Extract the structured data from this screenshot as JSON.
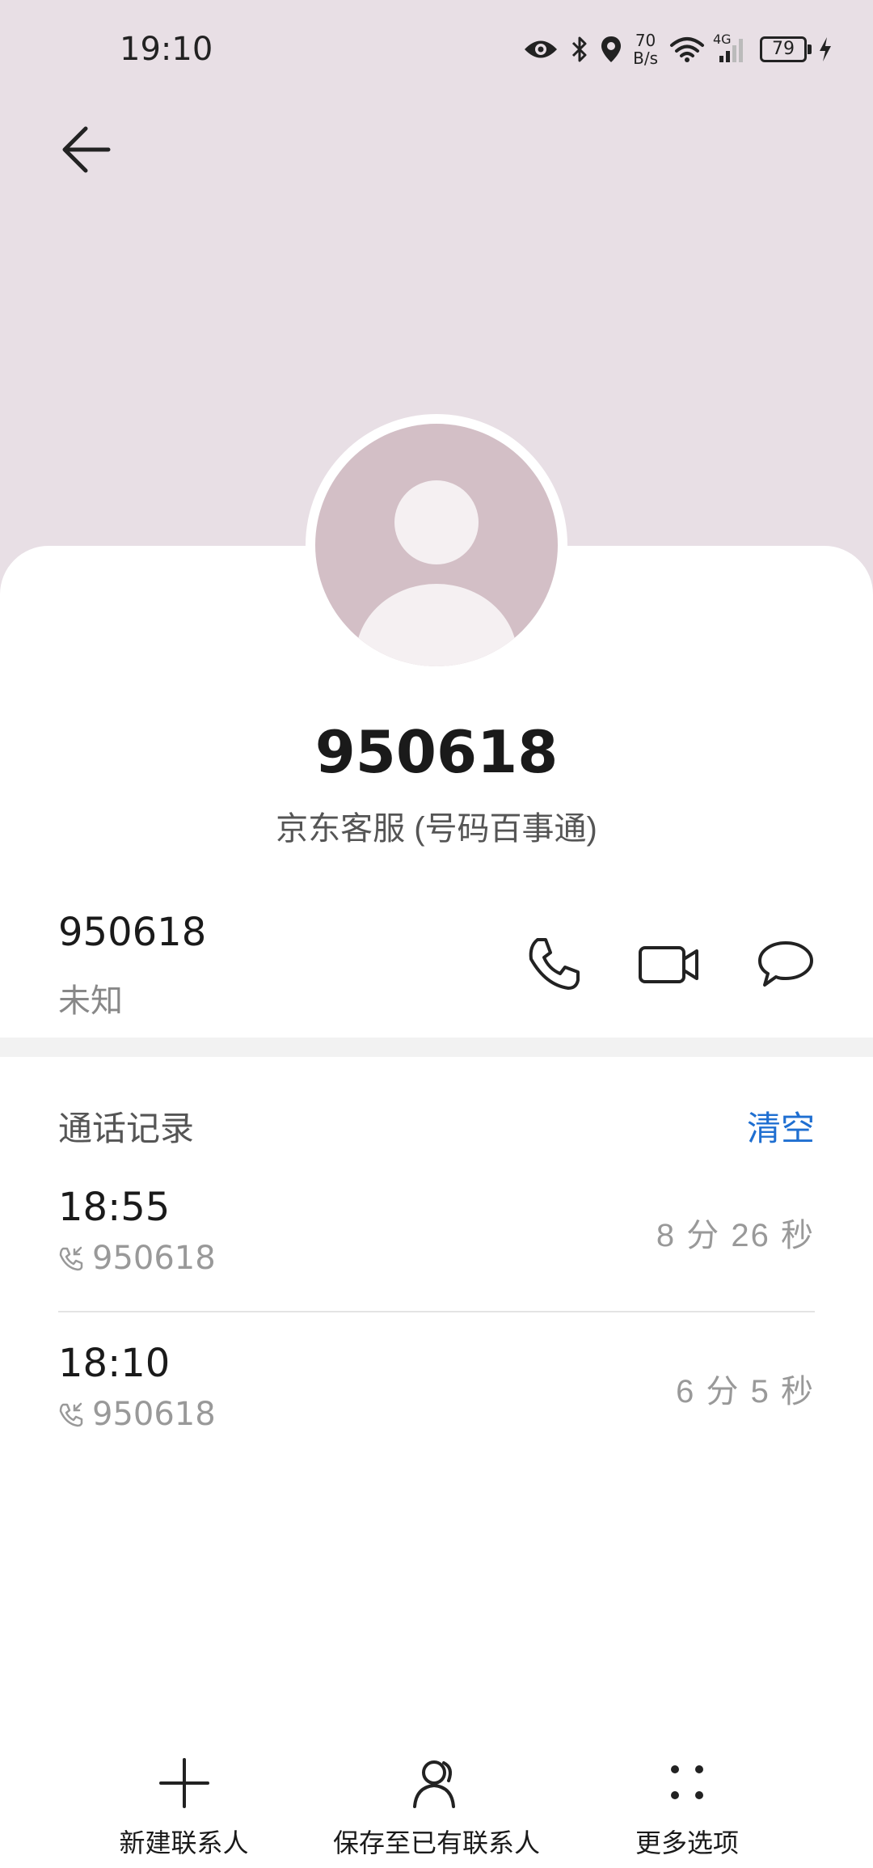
{
  "status_bar": {
    "time": "19:10",
    "net_speed_value": "70",
    "net_speed_unit": "B/s",
    "network_type": "4G",
    "battery": "79",
    "icons": [
      "eye-icon",
      "bluetooth-icon",
      "location-icon",
      "wifi-icon",
      "signal-icon",
      "battery-icon",
      "charging-icon"
    ]
  },
  "header": {
    "back_icon": "arrow-left-icon",
    "background_color": "#e8dfe5"
  },
  "contact": {
    "name": "950618",
    "subtitle": "京东客服 (号码百事通)",
    "avatar_color": "#d3bfc6"
  },
  "number_row": {
    "number": "950618",
    "label": "未知",
    "actions": [
      {
        "icon": "phone-icon"
      },
      {
        "icon": "video-call-icon"
      },
      {
        "icon": "message-icon"
      }
    ]
  },
  "call_log": {
    "title": "通话记录",
    "clear_label": "清空",
    "accent_color": "#1f6fd1",
    "entries": [
      {
        "time": "18:55",
        "number": "950618",
        "duration": "8 分 26 秒",
        "icon": "incoming-call-icon"
      },
      {
        "time": "18:10",
        "number": "950618",
        "duration": "6 分 5 秒",
        "icon": "incoming-call-icon"
      }
    ]
  },
  "bottom_bar": {
    "items": [
      {
        "label": "新建联系人",
        "icon": "plus-icon"
      },
      {
        "label": "保存至已有联系人",
        "icon": "person-add-icon"
      },
      {
        "label": "更多选项",
        "icon": "more-dots-icon"
      }
    ]
  }
}
